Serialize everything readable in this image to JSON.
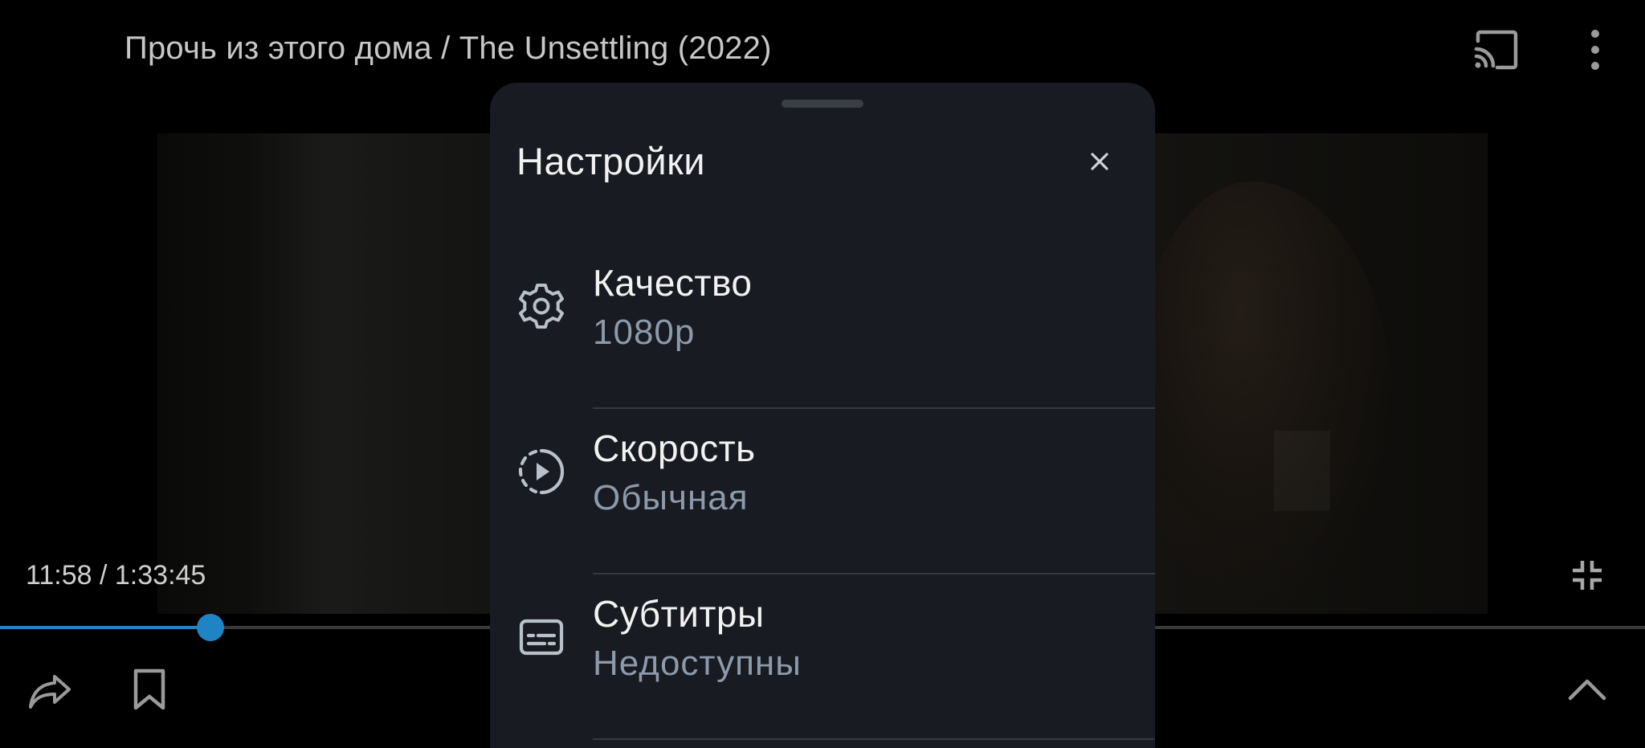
{
  "player": {
    "title": "Прочь из этого дома / The Unsettling (2022)",
    "time_readout": "11:58 / 1:33:45",
    "progress_fraction": 0.1277,
    "accent_color": "#1f84c4",
    "top_icons": [
      "cast-icon",
      "more-vert-icon"
    ],
    "bottom_icons": [
      "share-icon",
      "bookmark-icon",
      "exit-fullscreen-icon",
      "chevron-up-icon"
    ]
  },
  "settings": {
    "title": "Настройки",
    "close_icon": "close-icon",
    "items": [
      {
        "label": "Качество",
        "value": "1080p",
        "icon": "gear-icon"
      },
      {
        "label": "Скорость",
        "value": "Обычная",
        "icon": "playback-speed-icon"
      },
      {
        "label": "Субтитры",
        "value": "Недоступны",
        "icon": "subtitles-icon"
      }
    ]
  }
}
